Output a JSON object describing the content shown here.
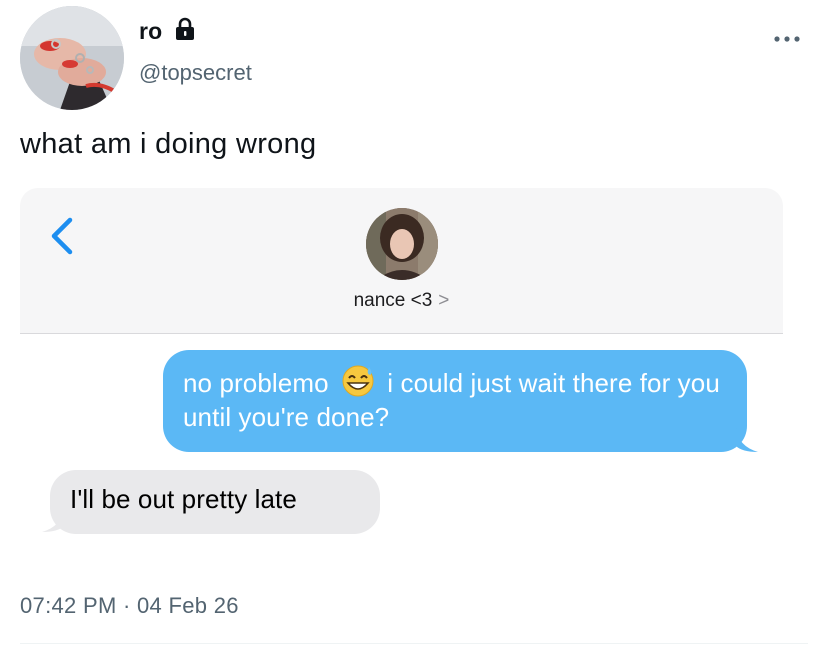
{
  "author": {
    "display_name": "ro",
    "handle": "@topsecret",
    "avatar_icon": "avatar-hands-with-rings",
    "protected_icon": "lock-icon"
  },
  "menu_icon": "more-horizontal-icon",
  "tweet": {
    "text": "what am i doing wrong",
    "timestamp": "07:42 PM · 04 Feb 26"
  },
  "screenshot": {
    "contact": {
      "name": "nance <3",
      "chevron": ">",
      "avatar_icon": "contact-photo"
    },
    "messages": [
      {
        "direction": "sent",
        "text_before_emoji": "no problemo ",
        "emoji": "grinning-face-with-sweat",
        "text_after_emoji": " i could just wait there for you until you're done?"
      },
      {
        "direction": "received",
        "text": "I'll be out pretty late"
      }
    ],
    "colors": {
      "sent_bubble": "#5bb8f5",
      "received_bubble": "#e9e9eb",
      "accent": "#1d8ef0"
    }
  }
}
